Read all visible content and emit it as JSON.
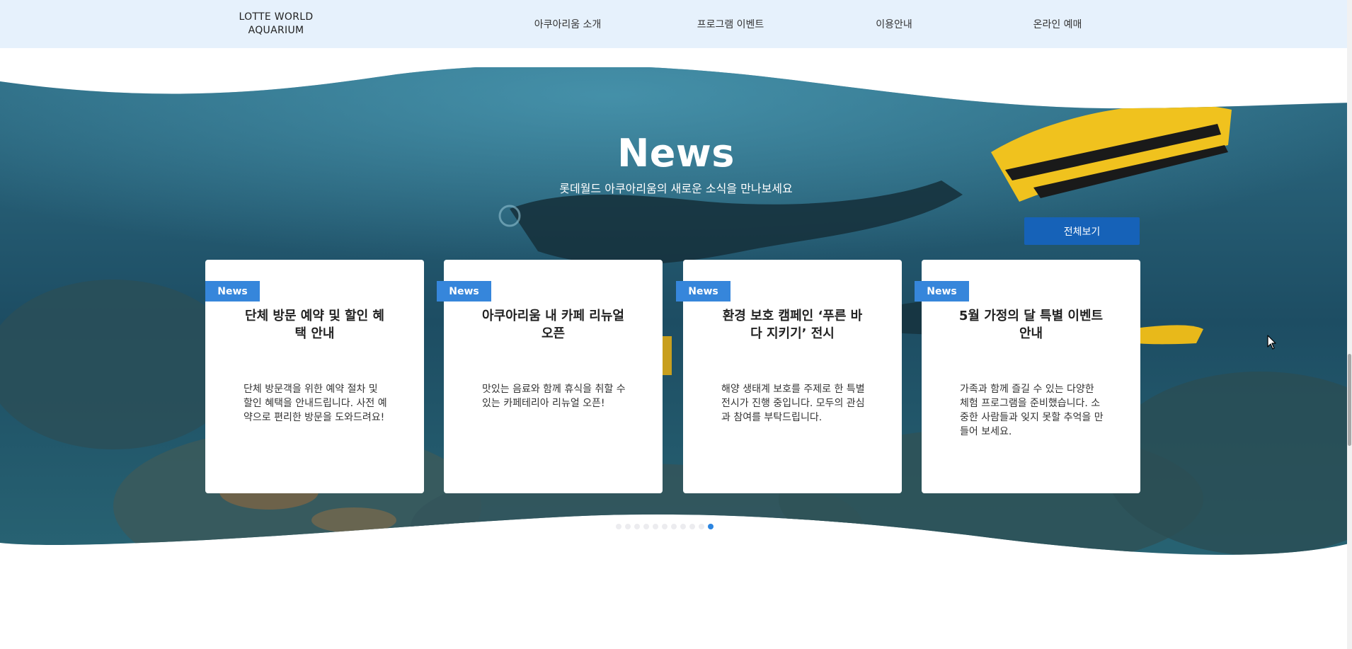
{
  "header": {
    "logo_line1": "LOTTE WORLD",
    "logo_line2": "AQUARIUM",
    "nav": [
      {
        "label": "아쿠아리움 소개"
      },
      {
        "label": "프로그램 이벤트"
      },
      {
        "label": "이용안내"
      },
      {
        "label": "온라인 예매"
      }
    ]
  },
  "news": {
    "title": "News",
    "subtitle": "롯데월드 아쿠아리움의 새로운 소식을 만나보세요",
    "view_all_label": "전체보기",
    "cards": [
      {
        "badge": "News",
        "title": "단체 방문 예약 및 할인 혜택 안내",
        "desc": "단체 방문객을 위한 예약 절차 및 할인 혜택을 안내드립니다. 사전 예약으로 편리한 방문을 도와드려요!"
      },
      {
        "badge": "News",
        "title": "아쿠아리움 내 카페 리뉴얼 오픈",
        "desc": "맛있는 음료와 함께 휴식을 취할 수 있는 카페테리아 리뉴얼 오픈!"
      },
      {
        "badge": "News",
        "title": "환경 보호 캠페인 ‘푸른 바다 지키기’ 전시",
        "desc": "해양 생태계 보호를 주제로 한 특별 전시가 진행 중입니다. 모두의 관심과 참여를 부탁드립니다."
      },
      {
        "badge": "News",
        "title": "5월 가정의 달 특별 이벤트 안내",
        "desc": "가족과 함께 즐길 수 있는 다양한 체험 프로그램을 준비했습니다. 소중한 사람들과 잊지 못할 추억을 만들어 보세요."
      }
    ],
    "pagination": {
      "count": 11,
      "active": 11
    }
  },
  "colors": {
    "header_bg": "#e6f1fc",
    "badge": "#3686db",
    "button": "#1662b8",
    "active_dot": "#2c85e0",
    "water_deep": "#1c4a5c",
    "water_light": "#2f7a8e"
  },
  "icons": {
    "cursor": "mouse-pointer-icon"
  }
}
